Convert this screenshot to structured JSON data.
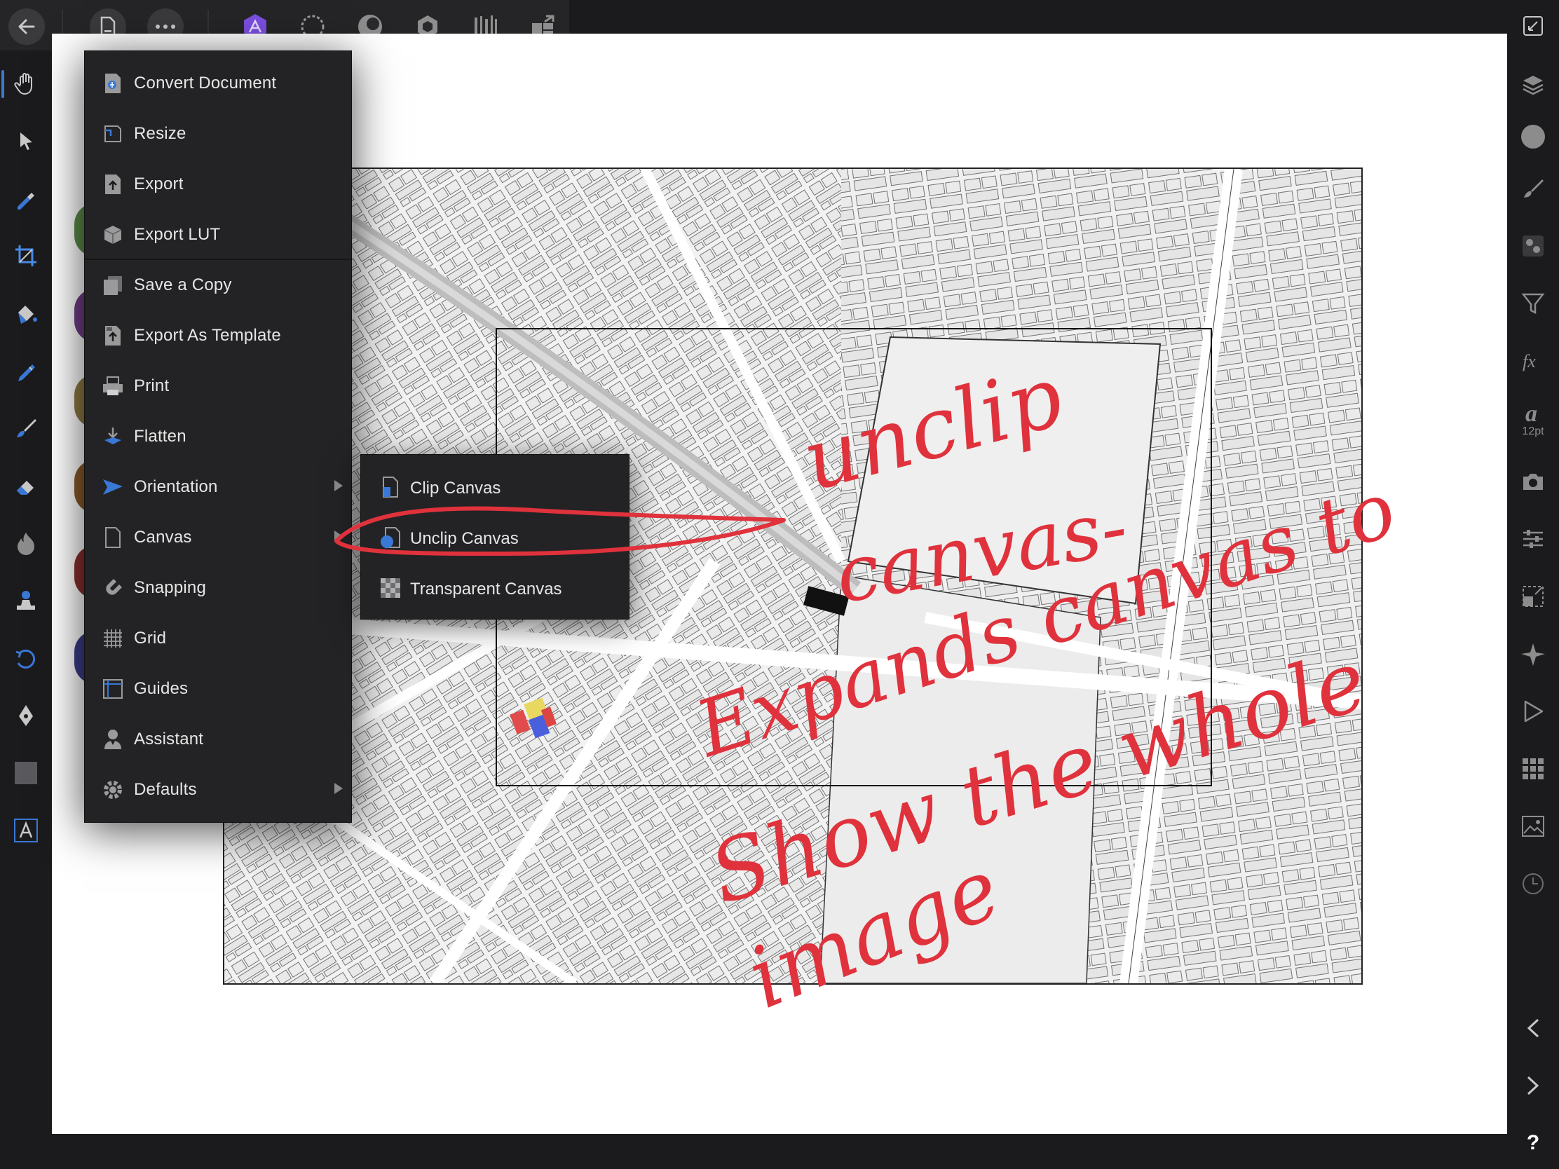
{
  "app": {
    "accent": "#7b4fe0",
    "selection_blue": "#3a78d6",
    "annotation_red": "#e0323c"
  },
  "topbar": {
    "icons": [
      "back-arrow-icon",
      "document-icon",
      "more-icon",
      "photo-persona-icon",
      "liquify-persona-icon",
      "develop-persona-icon",
      "tone-mapping-persona-icon",
      "export-persona-icon",
      "layout-persona-icon"
    ]
  },
  "main_menu": {
    "items": [
      {
        "label": "Convert Document",
        "icon": "convert-document-icon",
        "submenu": false
      },
      {
        "label": "Resize",
        "icon": "resize-icon",
        "submenu": false
      },
      {
        "label": "Export",
        "icon": "export-icon",
        "submenu": false
      },
      {
        "label": "Export LUT",
        "icon": "export-lut-icon",
        "submenu": false
      },
      {
        "label": "Save a Copy",
        "icon": "save-copy-icon",
        "submenu": false
      },
      {
        "label": "Export As Template",
        "icon": "export-template-icon",
        "submenu": false
      },
      {
        "label": "Print",
        "icon": "print-icon",
        "submenu": false
      },
      {
        "label": "Flatten",
        "icon": "flatten-icon",
        "submenu": false
      },
      {
        "label": "Orientation",
        "icon": "orientation-icon",
        "submenu": true
      },
      {
        "label": "Canvas",
        "icon": "canvas-icon",
        "submenu": true
      },
      {
        "label": "Snapping",
        "icon": "snapping-icon",
        "submenu": false
      },
      {
        "label": "Grid",
        "icon": "grid-icon",
        "submenu": false
      },
      {
        "label": "Guides",
        "icon": "guides-icon",
        "submenu": false
      },
      {
        "label": "Assistant",
        "icon": "assistant-icon",
        "submenu": false
      },
      {
        "label": "Defaults",
        "icon": "defaults-icon",
        "submenu": true
      }
    ]
  },
  "canvas_submenu": {
    "items": [
      {
        "label": "Clip Canvas",
        "icon": "clip-canvas-icon"
      },
      {
        "label": "Unclip Canvas",
        "icon": "unclip-canvas-icon"
      },
      {
        "label": "Transparent Canvas",
        "icon": "transparent-canvas-icon"
      }
    ]
  },
  "right_sidebar": {
    "font_size_label": "12pt",
    "help_label": "?"
  },
  "annotation": {
    "lines": [
      "unclip",
      "canvas-",
      "Expands canvas to",
      "Show the whole",
      "image"
    ]
  }
}
